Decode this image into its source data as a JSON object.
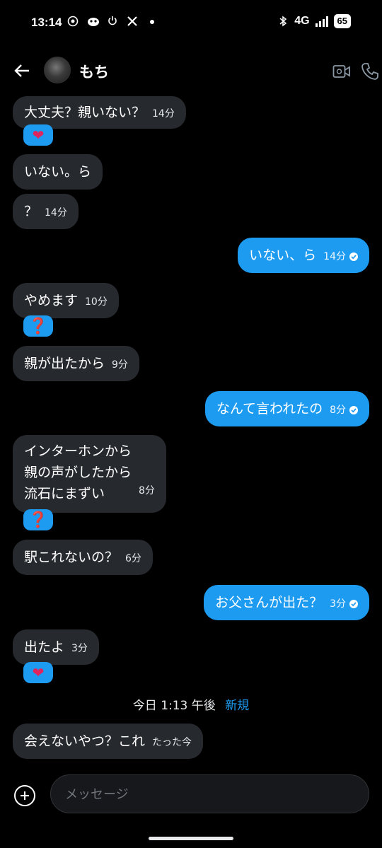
{
  "status_bar": {
    "time": "13:14",
    "network": "4G",
    "battery": "65"
  },
  "header": {
    "back_icon": "arrow-left-icon",
    "contact_name": "もち",
    "video_icon": "video-camera-icon",
    "call_icon": "phone-icon"
  },
  "messages": [
    {
      "dir": "in",
      "text": "大丈夫？親いない？",
      "time": "14分",
      "reaction": "heart"
    },
    {
      "dir": "in",
      "text": "いない。ら",
      "time": ""
    },
    {
      "dir": "in",
      "text": "？",
      "time": "14分"
    },
    {
      "dir": "out",
      "text": "いない、ら",
      "time": "14分"
    },
    {
      "dir": "in",
      "text": "やめます",
      "time": "10分",
      "reaction": "question"
    },
    {
      "dir": "in",
      "text": "親が出たから",
      "time": "9分"
    },
    {
      "dir": "out",
      "text": "なんて言われたの",
      "time": "8分"
    },
    {
      "dir": "in",
      "lines": [
        "インターホンから",
        "親の声がしたから",
        "流石にまずい"
      ],
      "time": "8分",
      "reaction": "question"
    },
    {
      "dir": "in",
      "text": "駅これないの？",
      "time": "6分"
    },
    {
      "dir": "out",
      "text": "お父さんが出た？",
      "time": "3分"
    },
    {
      "dir": "in",
      "text": "出たよ",
      "time": "3分",
      "reaction": "heart"
    },
    {
      "dir": "in",
      "text": "会えないやつ？これ",
      "time": "たった今"
    }
  ],
  "divider": {
    "time": "今日 1:13 午後",
    "new_label": "新規"
  },
  "reactions": {
    "heart": "❤",
    "question": "❓"
  },
  "composer": {
    "placeholder": "メッセージ"
  },
  "colors": {
    "accent": "#1d9bf0",
    "incoming_bubble": "#26292e",
    "background": "#000000"
  }
}
